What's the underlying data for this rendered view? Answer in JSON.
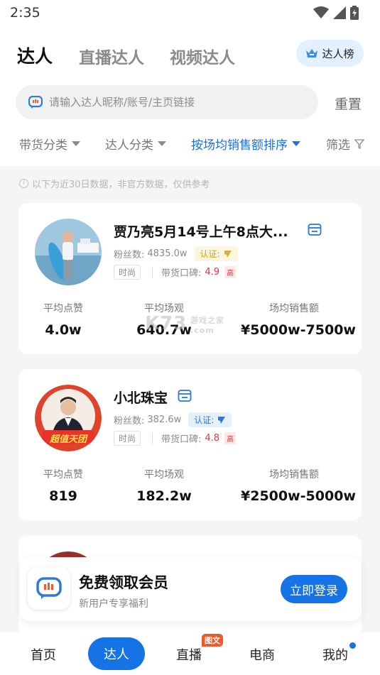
{
  "status_bar": {
    "time": "2:35"
  },
  "header": {
    "tabs": [
      "达人",
      "直播达人",
      "视频达人"
    ],
    "rank_button": "达人榜"
  },
  "search": {
    "placeholder": "请输入达人昵称/账号/主页链接",
    "reset": "重置"
  },
  "filters": [
    "带货分类",
    "达人分类",
    "按场均销售额排序",
    "筛选"
  ],
  "notice": "以下为近30日数据，非官方数据，仅供参考",
  "cards": [
    {
      "name": "贾乃亮5月14号上午8点大...",
      "fans_label": "粉丝数:",
      "fans": "4835.0w",
      "verify_label": "认证:",
      "tag": "时尚",
      "rating_label": "带货口碑:",
      "rating": "4.9",
      "rating_level": "高",
      "metrics": [
        {
          "label": "平均点赞",
          "value": "4.0w"
        },
        {
          "label": "平均场观",
          "value": "640.7w"
        },
        {
          "label": "场均销售额",
          "value": "¥5000w-7500w"
        }
      ],
      "verify_color": "#c9a227"
    },
    {
      "name": "小北珠宝",
      "fans_label": "粉丝数:",
      "fans": "382.6w",
      "verify_label": "认证:",
      "tag": "时尚",
      "rating_label": "带货口碑:",
      "rating": "4.8",
      "rating_level": "高",
      "avatar_text": "超值天团",
      "metrics": [
        {
          "label": "平均点赞",
          "value": "819"
        },
        {
          "label": "平均场观",
          "value": "182.2w"
        },
        {
          "label": "场均销售额",
          "value": "¥2500w-5000w"
        }
      ],
      "verify_color": "#2a78d8"
    }
  ],
  "watermark": {
    "main": "K73",
    "sub": "游戏之家",
    "domain": ".com"
  },
  "promo": {
    "title": "免费领取会员",
    "subtitle": "新用户专享福利",
    "button": "立即登录"
  },
  "bottom_nav": {
    "items": [
      "首页",
      "达人",
      "直播",
      "电商",
      "我的"
    ],
    "live_badge": "图文",
    "active": "达人"
  },
  "colors": {
    "accent": "#1673e6",
    "rating": "#e0383e",
    "notice": "#b5b5b5"
  }
}
